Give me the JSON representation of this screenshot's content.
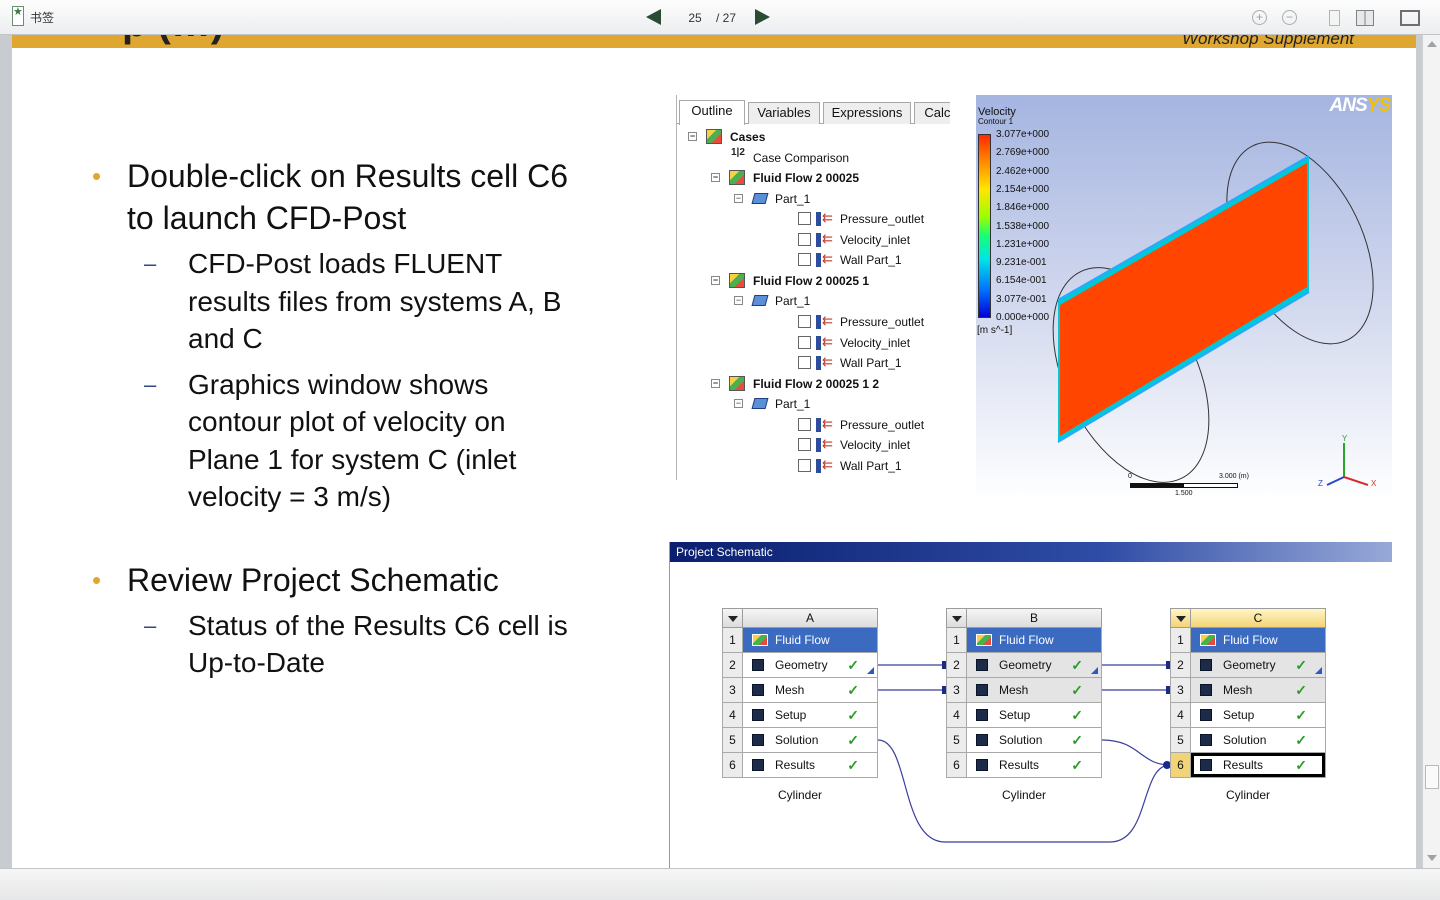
{
  "toolbar": {
    "bookmark_label": "书签",
    "current_page": "25",
    "total_pages": "/ 27"
  },
  "slide": {
    "band_title": "p                 (…)",
    "band_subtitle": "Workshop Supplement",
    "bullets": [
      {
        "text_lines": [
          "Double-click on Results cell C6",
          "to launch CFD-Post"
        ],
        "subs": [
          {
            "lines": [
              "CFD-Post loads FLUENT",
              "results files from systems A, B",
              "and C"
            ]
          },
          {
            "lines": [
              "Graphics window shows",
              "contour plot of velocity on",
              "Plane 1 for system C (inlet",
              "velocity = 3 m/s)"
            ]
          }
        ]
      },
      {
        "text_lines": [
          "Review Project Schematic"
        ],
        "subs": [
          {
            "lines": [
              "Status of the Results C6 cell is",
              "Up-to-Date"
            ]
          }
        ]
      }
    ]
  },
  "outline": {
    "tabs": [
      "Outline",
      "Variables",
      "Expressions",
      "Calcu"
    ],
    "tree": [
      {
        "label": "Cases",
        "kind": "root"
      },
      {
        "label": "Case Comparison",
        "kind": "compare"
      },
      {
        "label": "Fluid Flow 2 00025",
        "kind": "case"
      },
      {
        "label": "Part_1",
        "kind": "part"
      },
      {
        "label": "Pressure_outlet",
        "kind": "bnd"
      },
      {
        "label": "Velocity_inlet",
        "kind": "bnd"
      },
      {
        "label": "Wall Part_1",
        "kind": "bnd"
      },
      {
        "label": "Fluid Flow 2 00025 1",
        "kind": "case"
      },
      {
        "label": "Part_1",
        "kind": "part"
      },
      {
        "label": "Pressure_outlet",
        "kind": "bnd"
      },
      {
        "label": "Velocity_inlet",
        "kind": "bnd"
      },
      {
        "label": "Wall Part_1",
        "kind": "bnd"
      },
      {
        "label": "Fluid Flow 2 00025 1 2",
        "kind": "case"
      },
      {
        "label": "Part_1",
        "kind": "part"
      },
      {
        "label": "Pressure_outlet",
        "kind": "bnd"
      },
      {
        "label": "Velocity_inlet",
        "kind": "bnd"
      },
      {
        "label": "Wall Part_1",
        "kind": "bnd"
      }
    ],
    "compare_icon": "1|2"
  },
  "graphics": {
    "title": "Velocity",
    "subtitle": "Contour 1",
    "legend": [
      "3.077e+000",
      "2.769e+000",
      "2.462e+000",
      "2.154e+000",
      "1.846e+000",
      "1.538e+000",
      "1.231e+000",
      "9.231e-001",
      "6.154e-001",
      "3.077e-001",
      "0.000e+000"
    ],
    "unit": "[m s^-1]",
    "logo_main": "ANS",
    "logo_accent": "YS",
    "scale_labels": {
      "start": "0",
      "mid": "1.500",
      "end": "3.000  (m)"
    },
    "axis_labels": {
      "x": "X",
      "y": "Y",
      "z": "Z"
    },
    "colors": {
      "plane": "#ff4500",
      "edge": "#00c8d8"
    }
  },
  "schematic": {
    "title": "Project Schematic",
    "systems": [
      {
        "letter": "A",
        "name": "Cylinder",
        "active": false
      },
      {
        "letter": "B",
        "name": "Cylinder",
        "active": false
      },
      {
        "letter": "C",
        "name": "Cylinder",
        "active": true
      }
    ],
    "rows": [
      "Fluid Flow",
      "Geometry",
      "Mesh",
      "Setup",
      "Solution",
      "Results"
    ],
    "row_numbers": [
      "1",
      "2",
      "3",
      "4",
      "5",
      "6"
    ],
    "check": "✓"
  }
}
